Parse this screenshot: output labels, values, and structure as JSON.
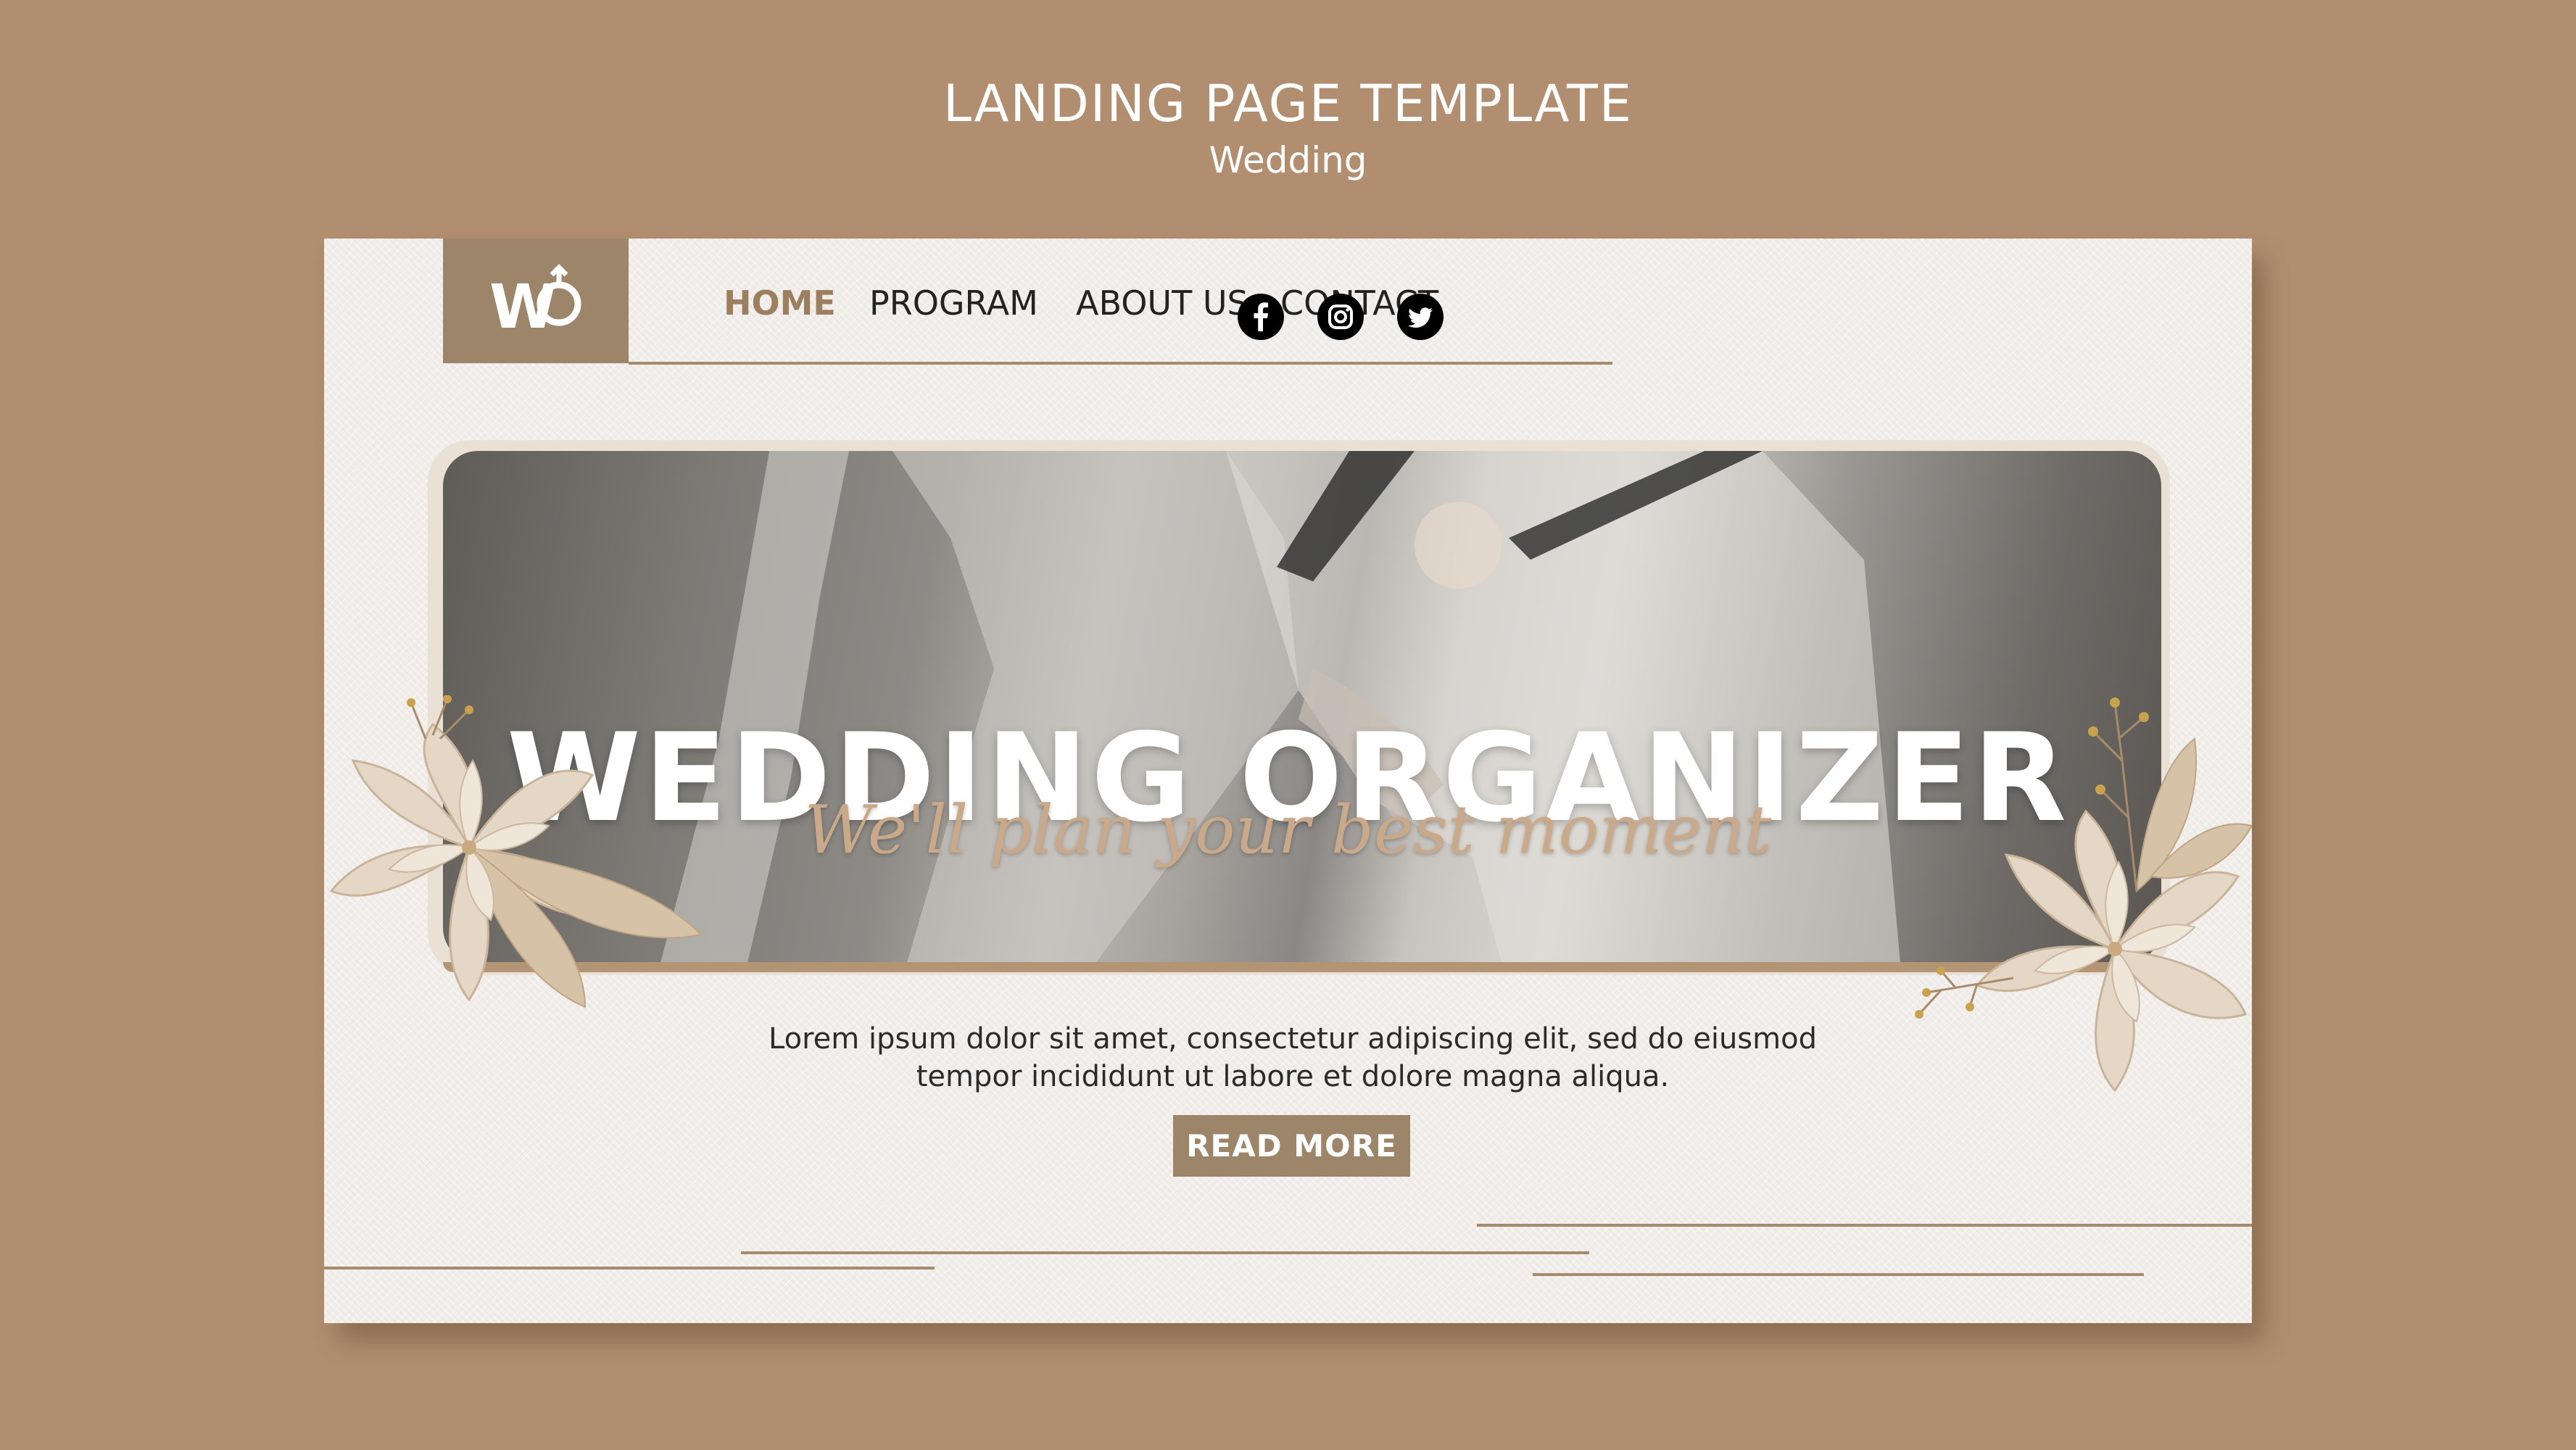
{
  "page": {
    "title": "LANDING PAGE TEMPLATE",
    "subtitle": "Wedding"
  },
  "logo": {
    "text": "W"
  },
  "nav": {
    "items": [
      {
        "label": "HOME",
        "active": true
      },
      {
        "label": "PROGRAM",
        "active": false
      },
      {
        "label": "ABOUT US",
        "active": false
      },
      {
        "label": "CONTACT",
        "active": false
      }
    ]
  },
  "social": {
    "icons": [
      "facebook-icon",
      "instagram-icon",
      "twitter-icon"
    ]
  },
  "hero": {
    "title": "WEDDING ORGANIZER",
    "tagline": "We'll plan your best moment"
  },
  "content": {
    "description": "Lorem ipsum dolor sit amet, consectetur adipiscing elit, sed do eiusmod tempor incididunt ut labore et dolore magna aliqua.",
    "button_label": "READ MORE"
  },
  "colors": {
    "background": "#b28e70",
    "card": "#f1eeeb",
    "accent": "#9c8569",
    "nav_active": "#9c7f5e",
    "script_text": "#c9a98a"
  }
}
